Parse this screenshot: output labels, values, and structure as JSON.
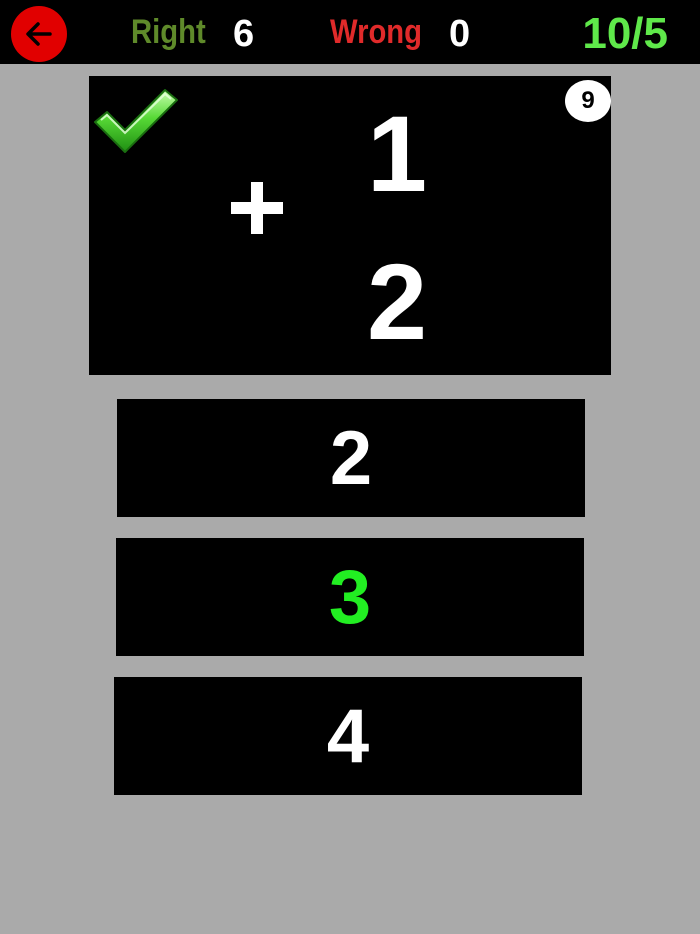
{
  "scoreboard": {
    "right_label": "Right",
    "right_value": "6",
    "wrong_label": "Wrong",
    "wrong_value": "0",
    "progress": "10/5"
  },
  "question": {
    "operator": "+",
    "operand_top": "1",
    "operand_bottom": "2",
    "timer": "9",
    "result_icon": "checkmark-icon"
  },
  "answers": [
    {
      "label": "2",
      "state": "normal"
    },
    {
      "label": "3",
      "state": "correct"
    },
    {
      "label": "4",
      "state": "normal"
    }
  ],
  "colors": {
    "background": "#aaaaaa",
    "right_label": "#5f8a2a",
    "wrong_label": "#e02a2a",
    "progress": "#5fe84a",
    "back_button": "#e10000",
    "correct_answer": "#22ee22"
  }
}
